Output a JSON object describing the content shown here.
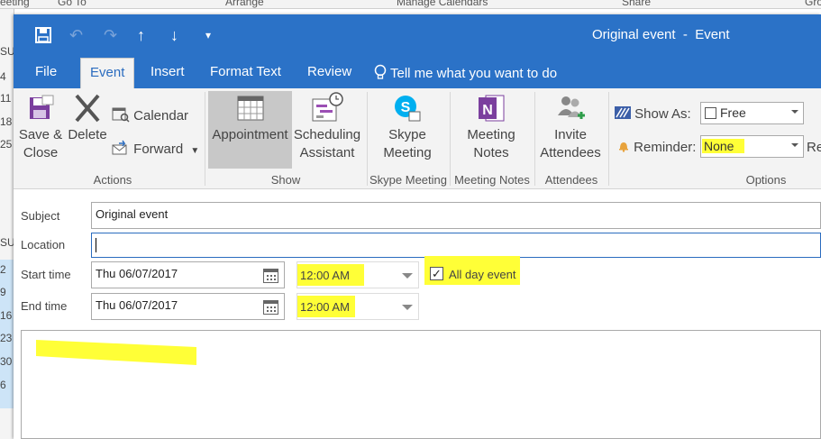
{
  "background": {
    "top_labels": [
      "eeting",
      "Go To",
      "Arrange",
      "Manage Calendars",
      "Share",
      "Gro"
    ],
    "left_labels": [
      "SU",
      "4",
      "11",
      "18",
      "25",
      "SU",
      "2",
      "9",
      "16",
      "23",
      "30",
      "6"
    ]
  },
  "window": {
    "title": "Original event  -  Event"
  },
  "qat": {
    "save_icon": "save-icon",
    "undo_icon": "undo-icon",
    "redo_icon": "redo-icon",
    "up_icon": "arrow-up-icon",
    "down_icon": "arrow-down-icon",
    "customize_icon": "customize-qat-icon"
  },
  "tabs": [
    "File",
    "Event",
    "Insert",
    "Format Text",
    "Review"
  ],
  "active_tab": "Event",
  "tell_me": "Tell me what you want to do",
  "ribbon": {
    "actions": {
      "save_close": "Save &\nClose",
      "delete": "Delete",
      "calendar": "Calendar",
      "forward": "Forward",
      "group": "Actions"
    },
    "show": {
      "appointment": "Appointment",
      "scheduling": "Scheduling\nAssistant",
      "group": "Show"
    },
    "skype": {
      "meeting": "Skype\nMeeting",
      "group": "Skype Meeting"
    },
    "notes": {
      "meeting_notes": "Meeting\nNotes",
      "group": "Meeting Notes"
    },
    "attendees": {
      "invite": "Invite\nAttendees",
      "group": "Attendees"
    },
    "options": {
      "show_as_label": "Show As:",
      "show_as_value": "Free",
      "reminder_label": "Reminder:",
      "reminder_value": "None",
      "recurrence_partial": "Re",
      "group": "Options"
    }
  },
  "form": {
    "subject_label": "Subject",
    "subject_value": "Original event",
    "location_label": "Location",
    "location_value": "",
    "start_label": "Start time",
    "start_date": "Thu 06/07/2017",
    "start_time": "12:00 AM",
    "all_day_label": "All day event",
    "all_day_checked": true,
    "end_label": "End time",
    "end_date": "Thu 06/07/2017",
    "end_time": "12:00 AM"
  },
  "colors": {
    "titlebar": "#2b72c7",
    "highlight": "#ffff37",
    "ribbon_bg": "#f3f3f3"
  }
}
